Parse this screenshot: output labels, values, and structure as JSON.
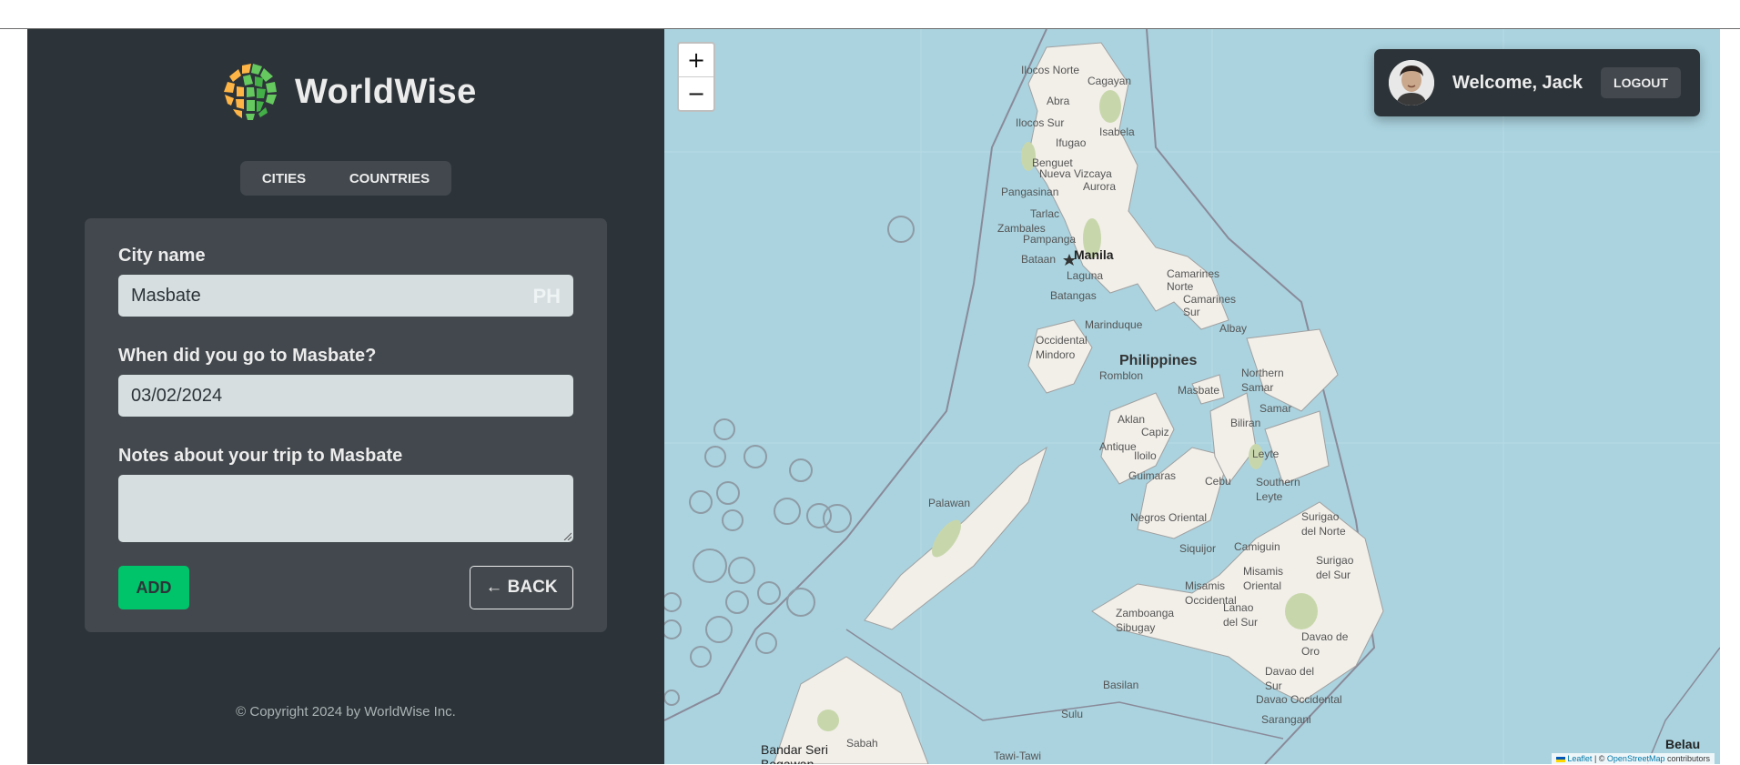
{
  "brand": {
    "name": "WorldWise"
  },
  "nav": {
    "cities": "Cities",
    "countries": "Countries"
  },
  "form": {
    "city_label": "City name",
    "city_value": "Masbate",
    "flag": "PH",
    "date_label": "When did you go to Masbate?",
    "date_value": "03/02/2024",
    "notes_label": "Notes about your trip to Masbate",
    "notes_value": "",
    "add_label": "ADD",
    "back_label": "← BACK"
  },
  "footer": {
    "copyright": "© Copyright 2024 by WorldWise Inc."
  },
  "map": {
    "zoom_in": "+",
    "zoom_out": "−",
    "places": {
      "ilocos_norte": "Ilocos Norte",
      "cagayan": "Cagayan",
      "abra": "Abra",
      "ilocos_sur": "Ilocos Sur",
      "isabela": "Isabela",
      "ifugao": "Ifugao",
      "benguet": "Benguet",
      "nueva_vizcaya": "Nueva Vizcaya",
      "aurora": "Aurora",
      "pangasinan": "Pangasinan",
      "tarlac": "Tarlac",
      "zambales": "Zambales",
      "pampanga": "Pampanga",
      "bataan": "Bataan",
      "manila": "Manila",
      "laguna": "Laguna",
      "batangas": "Batangas",
      "camarines_norte": "Camarines Norte",
      "camarines_sur": "Camarines Sur",
      "albay": "Albay",
      "marinduque": "Marinduque",
      "occidental_mindoro": "Occidental Mindoro",
      "philippines": "Philippines",
      "romblon": "Romblon",
      "masbate": "Masbate",
      "northern_samar": "Northern Samar",
      "samar": "Samar",
      "biliran": "Biliran",
      "leyte": "Leyte",
      "southern_leyte": "Southern Leyte",
      "aklan": "Aklan",
      "capiz": "Capiz",
      "antique": "Antique",
      "iloilo": "Iloilo",
      "guimaras": "Guimaras",
      "cebu": "Cebu",
      "palawan": "Palawan",
      "negros_oriental": "Negros Oriental",
      "siquijor": "Siquijor",
      "camiguin": "Camiguin",
      "surigao_del_norte": "Surigao del Norte",
      "surigao_del_sur": "Surigao del Sur",
      "misamis_occidental": "Misamis Occidental",
      "misamis_oriental": "Misamis Oriental",
      "lanao_del_sur": "Lanao del Sur",
      "zamboanga_sibugay": "Zamboanga Sibugay",
      "davao_de_oro": "Davao de Oro",
      "davao_del_sur": "Davao del Sur",
      "davao_occidental": "Davao Occidental",
      "basilan": "Basilan",
      "sulu": "Sulu",
      "sarangani": "Sarangani",
      "sabah": "Sabah",
      "bandar_seri_begawan": "Bandar Seri Begawan",
      "tawi_tawi": "Tawi-Tawi",
      "belau": "Belau"
    },
    "attribution": {
      "leaflet": "Leaflet",
      "sep": " | © ",
      "osm": "OpenStreetMap",
      "contrib": " contributors"
    }
  },
  "user": {
    "welcome": "Welcome, Jack",
    "logout": "Logout"
  }
}
